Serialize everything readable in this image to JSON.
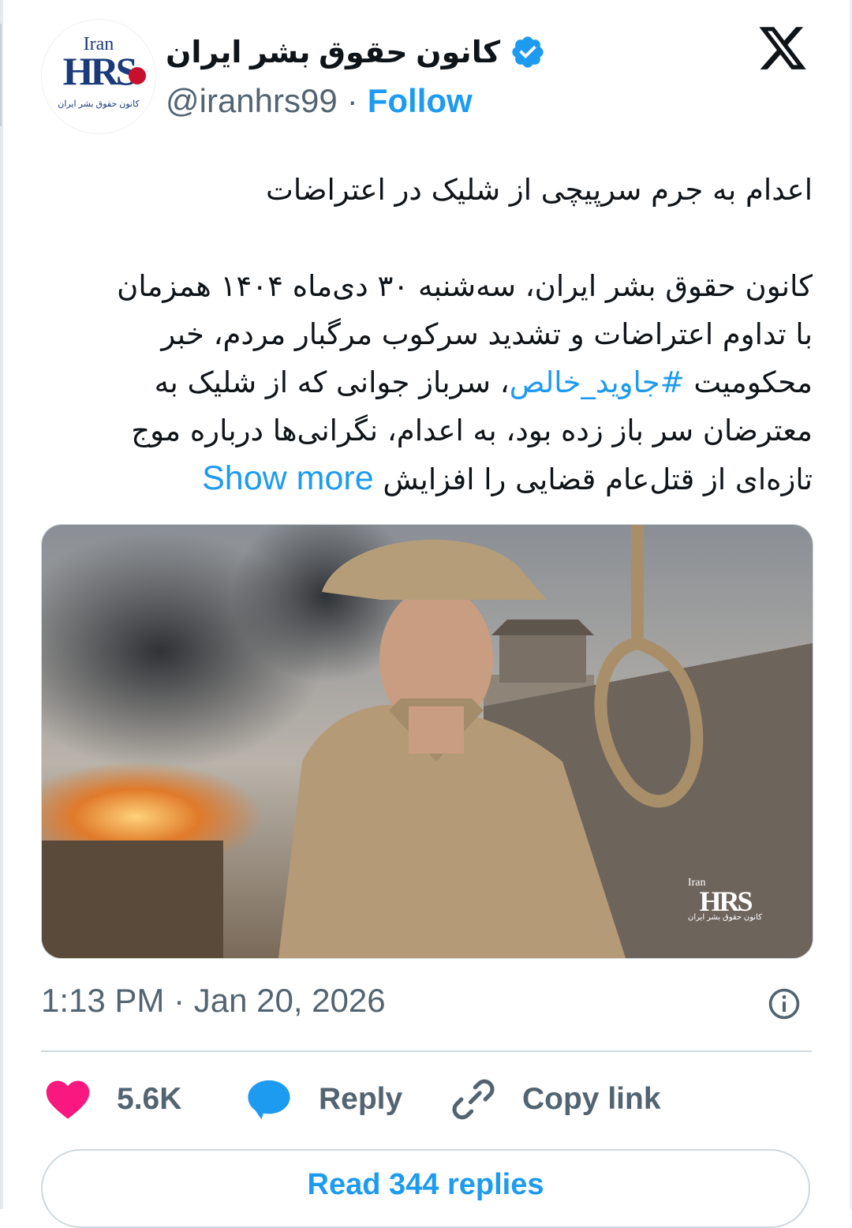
{
  "author": {
    "display_name": "کانون حقوق بشر ایران",
    "handle": "@iranhrs99",
    "separator": "·",
    "follow_label": "Follow",
    "verified": true,
    "avatar_logo": {
      "top_text": "Iran",
      "main_text": "HRS",
      "sub_text": "کانون حقوق بشر ایران"
    }
  },
  "tweet": {
    "headline": "اعدام به جرم سرپیچی از شلیک در اعتراضات",
    "body_before_hashtag": "کانون حقوق بشر ایران، سه‌شنبه ۳۰ دی‌ماه ۱۴۰۴ همزمان با تداوم اعتراضات و تشدید سرکوب مرگبار مردم، خبر محکومیت ",
    "hashtag": "#جاوید_خالص",
    "body_after_hashtag": "، سرباز جوانی که از شلیک به معترضان سر باز زده بود، به اعدام، نگرانی‌ها درباره موج تازه‌ای از قتل‌عام قضایی را افزایش",
    "show_more_label": "Show more"
  },
  "media": {
    "watermark_top": "Iran",
    "watermark_main": "HRS",
    "watermark_sub": "کانون حقوق بشر ایران"
  },
  "timestamp": "1:13 PM · Jan 20, 2026",
  "actions": {
    "likes_count": "5.6K",
    "reply_label": "Reply",
    "copy_link_label": "Copy link"
  },
  "read_replies_label": "Read 344 replies",
  "colors": {
    "accent": "#1d9bf0",
    "like": "#f91880",
    "secondary_text": "#536471",
    "border": "#cfd9de"
  },
  "icons": [
    "verified-badge-icon",
    "x-logo-icon",
    "info-icon",
    "heart-icon",
    "reply-bubble-icon",
    "link-icon"
  ]
}
